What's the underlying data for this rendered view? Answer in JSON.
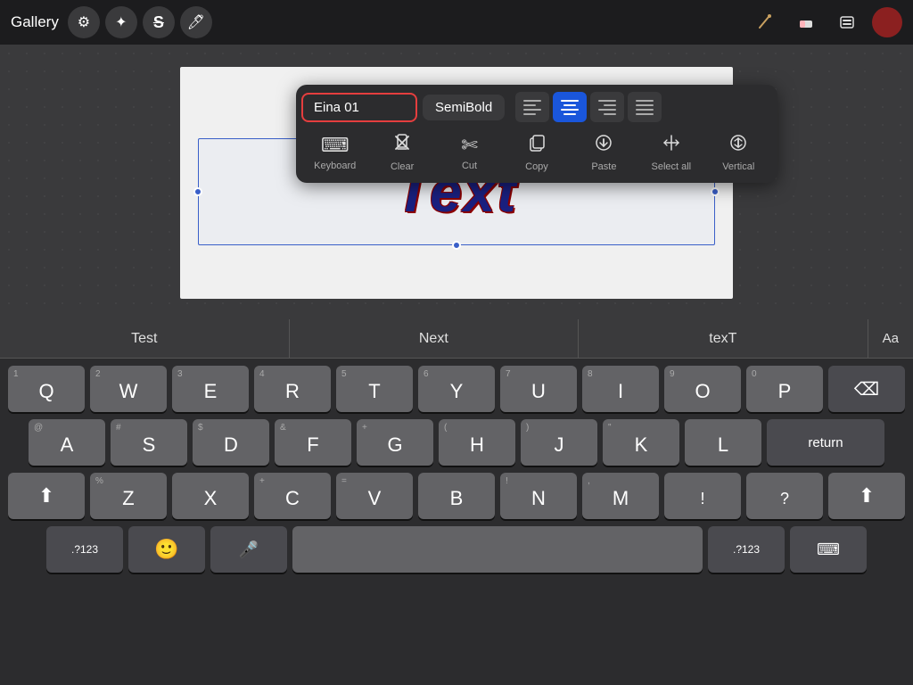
{
  "topbar": {
    "gallery_label": "Gallery",
    "icons": [
      "wrench",
      "magic",
      "strikethrough",
      "brush"
    ]
  },
  "toolbar": {
    "font_name": "Eina 01",
    "font_weight": "SemiBold",
    "align_options": [
      "left",
      "center",
      "right",
      "justify"
    ],
    "active_align": "center",
    "actions": [
      {
        "id": "keyboard",
        "label": "Keyboard",
        "icon": "⌨"
      },
      {
        "id": "clear",
        "label": "Clear",
        "icon": "✂"
      },
      {
        "id": "cut",
        "label": "Cut",
        "icon": "✄"
      },
      {
        "id": "copy",
        "label": "Copy",
        "icon": "⊕"
      },
      {
        "id": "paste",
        "label": "Paste",
        "icon": "⊖"
      },
      {
        "id": "select_all",
        "label": "Select all",
        "icon": "⇔"
      },
      {
        "id": "vertical",
        "label": "Vertical",
        "icon": "⇕"
      }
    ]
  },
  "canvas": {
    "text": "Text"
  },
  "autocomplete": {
    "suggestions": [
      "Test",
      "Next",
      "texT"
    ],
    "aa_label": "Aa"
  },
  "keyboard": {
    "row1": [
      {
        "letter": "Q",
        "num": "1"
      },
      {
        "letter": "W",
        "num": "2"
      },
      {
        "letter": "E",
        "num": "3"
      },
      {
        "letter": "R",
        "num": "4"
      },
      {
        "letter": "T",
        "num": "5"
      },
      {
        "letter": "Y",
        "num": "6"
      },
      {
        "letter": "U",
        "num": "7"
      },
      {
        "letter": "I",
        "num": "8"
      },
      {
        "letter": "O",
        "num": "9"
      },
      {
        "letter": "P",
        "num": "0"
      }
    ],
    "row2": [
      {
        "letter": "A",
        "sym": "@"
      },
      {
        "letter": "S",
        "sym": "#"
      },
      {
        "letter": "D",
        "sym": "$"
      },
      {
        "letter": "F",
        "sym": "&"
      },
      {
        "letter": "G",
        "sym": "+"
      },
      {
        "letter": "H",
        "sym": "("
      },
      {
        "letter": "J",
        "sym": ")"
      },
      {
        "letter": "K",
        "sym": "\""
      },
      {
        "letter": "L",
        "sym": ""
      }
    ],
    "row3": [
      {
        "letter": "Z",
        "sym": "%"
      },
      {
        "letter": "X",
        "sym": ""
      },
      {
        "letter": "C",
        "sym": "+"
      },
      {
        "letter": "V",
        "sym": "="
      },
      {
        "letter": "B",
        "sym": ""
      },
      {
        "letter": "N",
        "sym": "!"
      },
      {
        "letter": "M",
        "sym": ","
      },
      {
        "sym2": "."
      },
      {
        "sym3": "?"
      }
    ],
    "bottom": {
      "numbers_label": ".?123",
      "emoji": "🙂",
      "mic": "🎤",
      "space": "",
      "numbers_right": ".?123",
      "keyboard_icon": "⌨"
    },
    "return_label": "return",
    "backspace_icon": "⌫"
  }
}
